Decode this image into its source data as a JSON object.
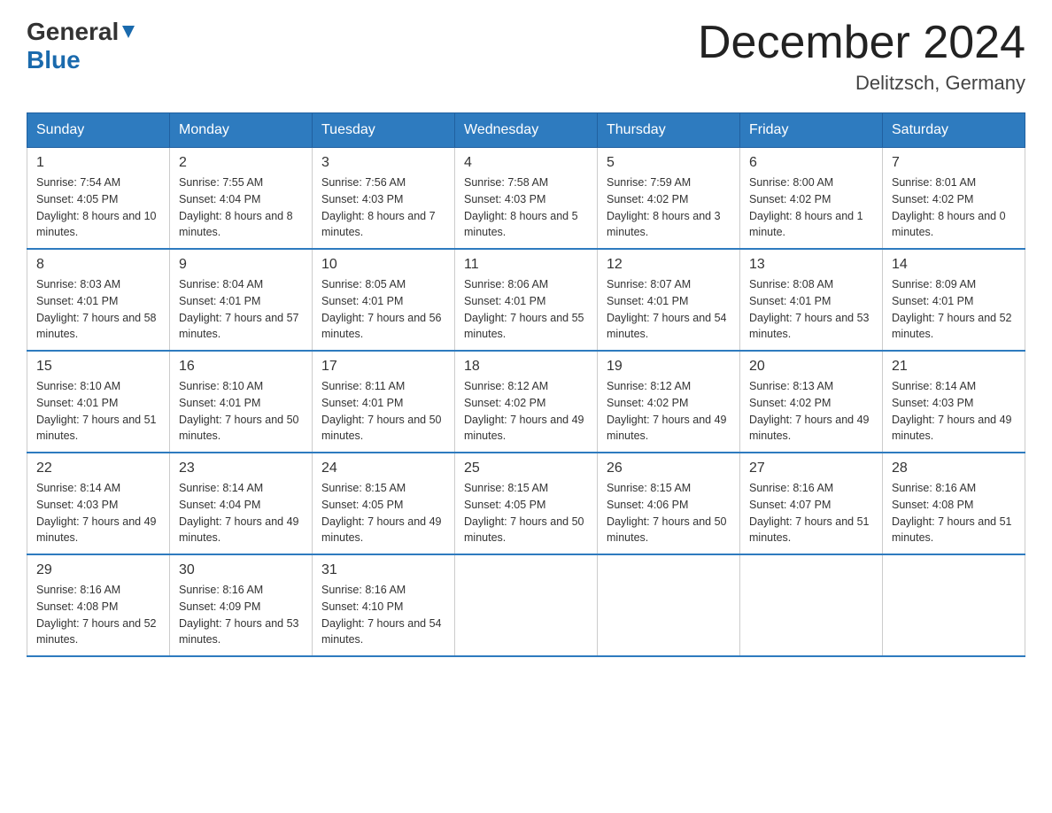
{
  "header": {
    "title": "December 2024",
    "subtitle": "Delitzsch, Germany",
    "logo_general": "General",
    "logo_blue": "Blue"
  },
  "weekdays": [
    "Sunday",
    "Monday",
    "Tuesday",
    "Wednesday",
    "Thursday",
    "Friday",
    "Saturday"
  ],
  "weeks": [
    [
      {
        "day": "1",
        "sunrise": "7:54 AM",
        "sunset": "4:05 PM",
        "daylight": "8 hours and 10 minutes."
      },
      {
        "day": "2",
        "sunrise": "7:55 AM",
        "sunset": "4:04 PM",
        "daylight": "8 hours and 8 minutes."
      },
      {
        "day": "3",
        "sunrise": "7:56 AM",
        "sunset": "4:03 PM",
        "daylight": "8 hours and 7 minutes."
      },
      {
        "day": "4",
        "sunrise": "7:58 AM",
        "sunset": "4:03 PM",
        "daylight": "8 hours and 5 minutes."
      },
      {
        "day": "5",
        "sunrise": "7:59 AM",
        "sunset": "4:02 PM",
        "daylight": "8 hours and 3 minutes."
      },
      {
        "day": "6",
        "sunrise": "8:00 AM",
        "sunset": "4:02 PM",
        "daylight": "8 hours and 1 minute."
      },
      {
        "day": "7",
        "sunrise": "8:01 AM",
        "sunset": "4:02 PM",
        "daylight": "8 hours and 0 minutes."
      }
    ],
    [
      {
        "day": "8",
        "sunrise": "8:03 AM",
        "sunset": "4:01 PM",
        "daylight": "7 hours and 58 minutes."
      },
      {
        "day": "9",
        "sunrise": "8:04 AM",
        "sunset": "4:01 PM",
        "daylight": "7 hours and 57 minutes."
      },
      {
        "day": "10",
        "sunrise": "8:05 AM",
        "sunset": "4:01 PM",
        "daylight": "7 hours and 56 minutes."
      },
      {
        "day": "11",
        "sunrise": "8:06 AM",
        "sunset": "4:01 PM",
        "daylight": "7 hours and 55 minutes."
      },
      {
        "day": "12",
        "sunrise": "8:07 AM",
        "sunset": "4:01 PM",
        "daylight": "7 hours and 54 minutes."
      },
      {
        "day": "13",
        "sunrise": "8:08 AM",
        "sunset": "4:01 PM",
        "daylight": "7 hours and 53 minutes."
      },
      {
        "day": "14",
        "sunrise": "8:09 AM",
        "sunset": "4:01 PM",
        "daylight": "7 hours and 52 minutes."
      }
    ],
    [
      {
        "day": "15",
        "sunrise": "8:10 AM",
        "sunset": "4:01 PM",
        "daylight": "7 hours and 51 minutes."
      },
      {
        "day": "16",
        "sunrise": "8:10 AM",
        "sunset": "4:01 PM",
        "daylight": "7 hours and 50 minutes."
      },
      {
        "day": "17",
        "sunrise": "8:11 AM",
        "sunset": "4:01 PM",
        "daylight": "7 hours and 50 minutes."
      },
      {
        "day": "18",
        "sunrise": "8:12 AM",
        "sunset": "4:02 PM",
        "daylight": "7 hours and 49 minutes."
      },
      {
        "day": "19",
        "sunrise": "8:12 AM",
        "sunset": "4:02 PM",
        "daylight": "7 hours and 49 minutes."
      },
      {
        "day": "20",
        "sunrise": "8:13 AM",
        "sunset": "4:02 PM",
        "daylight": "7 hours and 49 minutes."
      },
      {
        "day": "21",
        "sunrise": "8:14 AM",
        "sunset": "4:03 PM",
        "daylight": "7 hours and 49 minutes."
      }
    ],
    [
      {
        "day": "22",
        "sunrise": "8:14 AM",
        "sunset": "4:03 PM",
        "daylight": "7 hours and 49 minutes."
      },
      {
        "day": "23",
        "sunrise": "8:14 AM",
        "sunset": "4:04 PM",
        "daylight": "7 hours and 49 minutes."
      },
      {
        "day": "24",
        "sunrise": "8:15 AM",
        "sunset": "4:05 PM",
        "daylight": "7 hours and 49 minutes."
      },
      {
        "day": "25",
        "sunrise": "8:15 AM",
        "sunset": "4:05 PM",
        "daylight": "7 hours and 50 minutes."
      },
      {
        "day": "26",
        "sunrise": "8:15 AM",
        "sunset": "4:06 PM",
        "daylight": "7 hours and 50 minutes."
      },
      {
        "day": "27",
        "sunrise": "8:16 AM",
        "sunset": "4:07 PM",
        "daylight": "7 hours and 51 minutes."
      },
      {
        "day": "28",
        "sunrise": "8:16 AM",
        "sunset": "4:08 PM",
        "daylight": "7 hours and 51 minutes."
      }
    ],
    [
      {
        "day": "29",
        "sunrise": "8:16 AM",
        "sunset": "4:08 PM",
        "daylight": "7 hours and 52 minutes."
      },
      {
        "day": "30",
        "sunrise": "8:16 AM",
        "sunset": "4:09 PM",
        "daylight": "7 hours and 53 minutes."
      },
      {
        "day": "31",
        "sunrise": "8:16 AM",
        "sunset": "4:10 PM",
        "daylight": "7 hours and 54 minutes."
      },
      null,
      null,
      null,
      null
    ]
  ]
}
